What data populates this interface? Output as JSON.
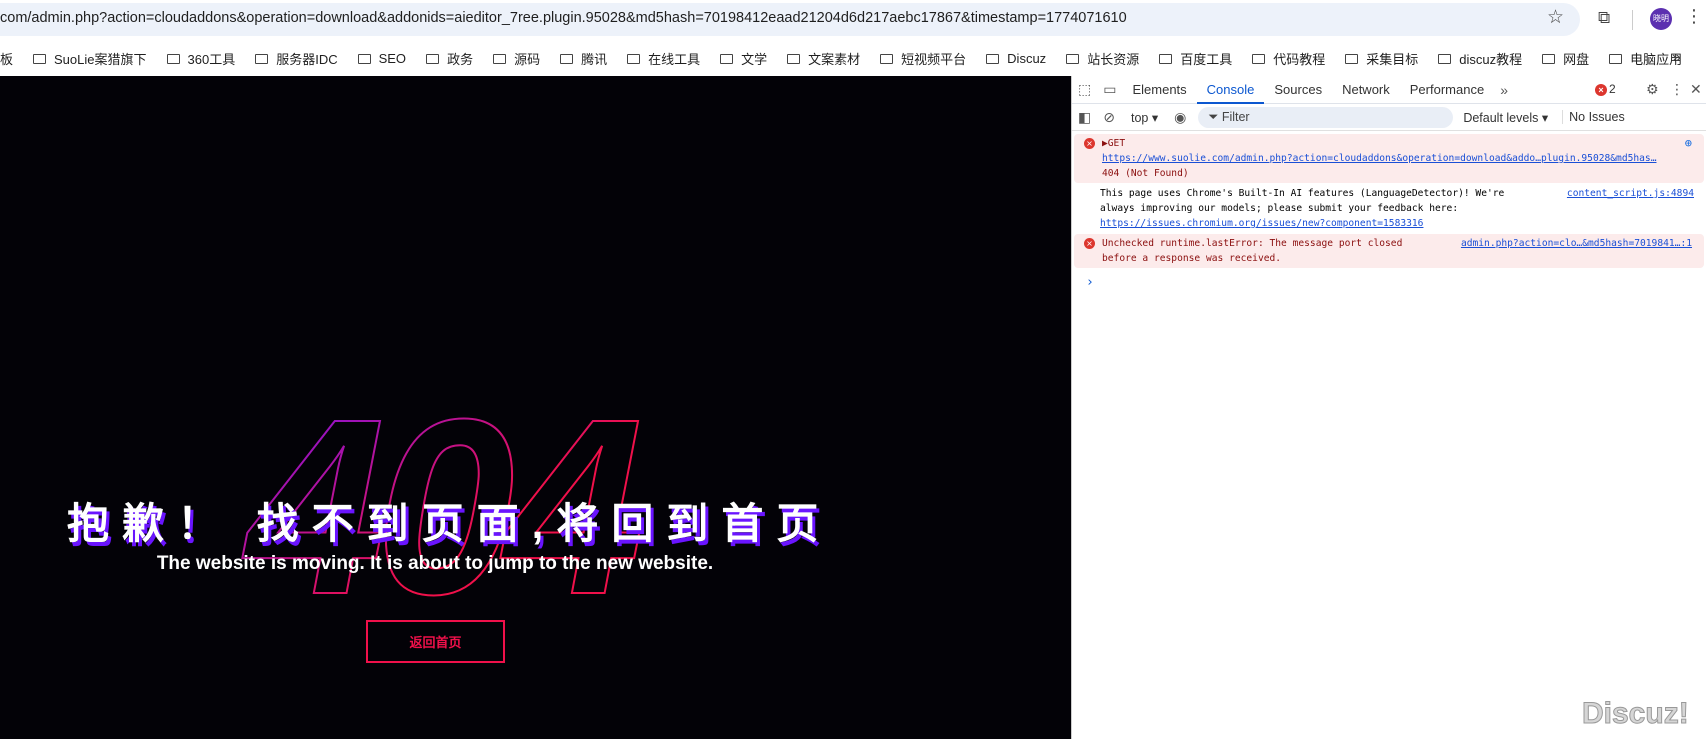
{
  "browser": {
    "url": "com/admin.php?action=cloudaddons&operation=download&addonids=aieditor_7ree.plugin.95028&md5hash=70198412eaad21204d6d217aebc17867&timestamp=1774071610",
    "avatar": "晓明",
    "bookmarks": [
      "板",
      "SuoLie案猎旗下",
      "360工具",
      "服务器IDC",
      "SEO",
      "政务",
      "源码",
      "腾讯",
      "在线工具",
      "文学",
      "文案素材",
      "短视频平台",
      "Discuz",
      "站长资源",
      "百度工具",
      "代码教程",
      "采集目标",
      "discuz教程",
      "网盘",
      "电脑应用"
    ]
  },
  "page": {
    "digits": "404",
    "title": "抱歉！ 找不到页面,将回到首页",
    "subtitle": "The website is moving. It is about to jump to the new website.",
    "button": "返回首页",
    "colors": {
      "bg": "#030207",
      "accent": "#f0104a",
      "purple": "#6a14ff"
    }
  },
  "devtools": {
    "tabs": [
      "Elements",
      "Console",
      "Sources",
      "Network",
      "Performance"
    ],
    "error_count": "2",
    "context": "top",
    "filter_placeholder": "Filter",
    "levels": "Default levels ▾",
    "issues": "No Issues",
    "messages": [
      {
        "type": "error",
        "lines": [
          "▶GET"
        ],
        "link": "https://www.suolie.com/admin.php?action=cloudaddons&operation=download&addo…plugin.95028&md5has…",
        "after": "404 (Not Found)"
      },
      {
        "type": "info",
        "text1": "This page uses Chrome's Built-In AI features (LanguageDetector)! We're",
        "text2": "always improving our models; please submit your feedback here:",
        "link": "https://issues.chromium.org/issues/new?component=1583316",
        "source": "content_script.js:4894"
      },
      {
        "type": "error",
        "text1": "Unchecked runtime.lastError: The message port closed",
        "text2": "before a response was received.",
        "source": "admin.php?action=clo…&md5hash=7019841…:1"
      }
    ]
  },
  "watermark": "Discuz!"
}
